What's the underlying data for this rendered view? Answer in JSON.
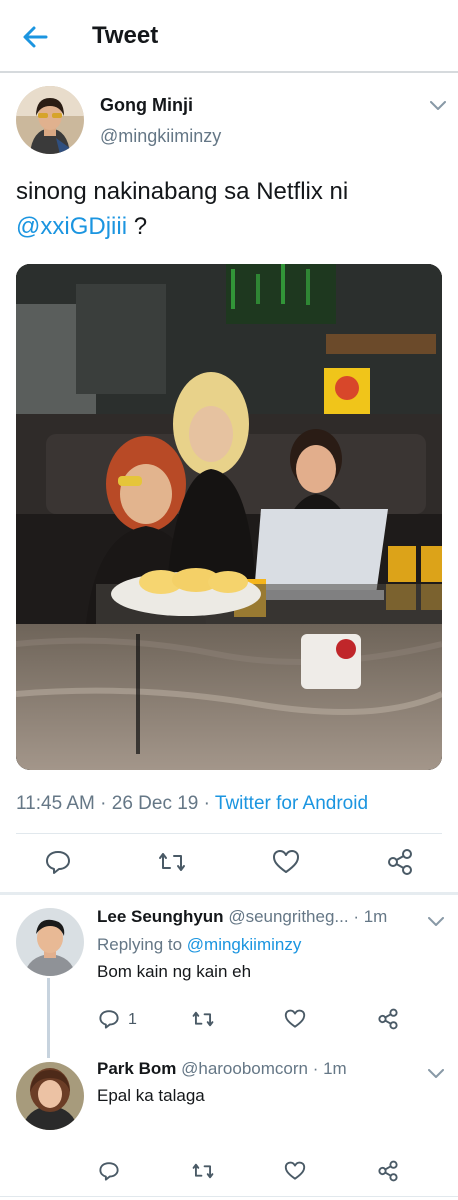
{
  "header": {
    "title": "Tweet",
    "back_icon": "back-arrow-icon"
  },
  "tweet": {
    "author_name": "Gong Minji",
    "author_handle": "@mingkiiminzy",
    "text_before_mention": "sinong nakinabang sa Netflix ni",
    "mention": "@xxiGDjiii",
    "text_after_mention": " ?",
    "photo_description_icon": "attached-photo",
    "time": "11:45 AM · 26 Dec 19 · ",
    "source": "Twitter for Android"
  },
  "replies": [
    {
      "author_name": "Lee Seunghyun",
      "author_handle": "@seungritheg...",
      "time": " · 1m",
      "replying_to_label": "Replying to ",
      "replying_to_handle": "@mingkiiminzy",
      "text": "Bom kain ng kain eh",
      "reply_count": "1"
    },
    {
      "author_name": "Park Bom",
      "author_handle": "@haroobomcorn",
      "time": " · 1m",
      "text": "Epal ka talaga"
    }
  ],
  "colors": {
    "accent": "#1b95e0",
    "muted": "#657786",
    "divider": "#e1e8ed"
  }
}
